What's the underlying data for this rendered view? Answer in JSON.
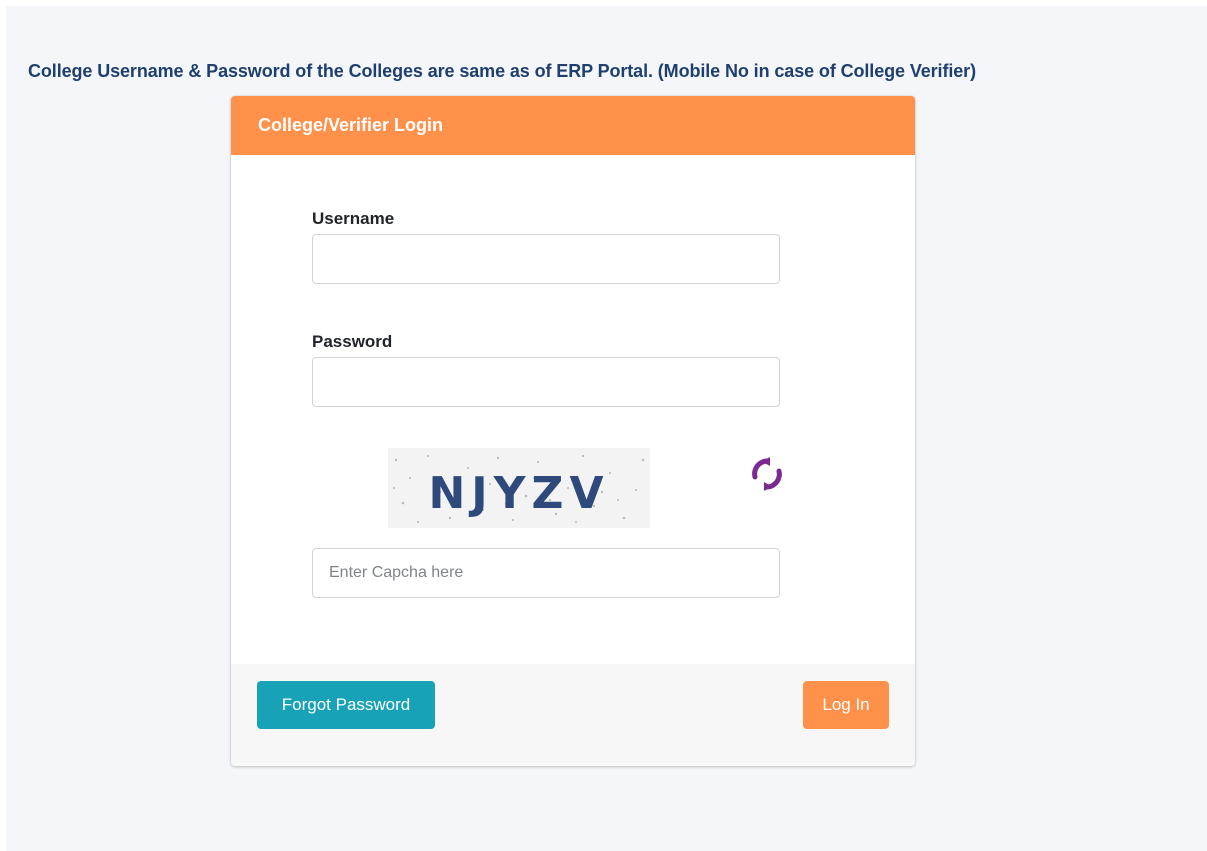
{
  "notice": "College Username & Password of the Colleges are same as of ERP Portal. (Mobile No in case of College Verifier)",
  "card": {
    "title": "College/Verifier Login"
  },
  "form": {
    "username_label": "Username",
    "username_value": "",
    "password_label": "Password",
    "password_value": "",
    "captcha_text": "NJYZV",
    "captcha_placeholder": "Enter Capcha here",
    "captcha_value": "",
    "refresh_icon": "refresh-icon"
  },
  "footer": {
    "forgot_label": "Forgot Password",
    "login_label": "Log In"
  },
  "colors": {
    "header": "#ff914a",
    "notice_text": "#1f3f6e",
    "forgot_button": "#17a2b8",
    "login_button": "#ff914a",
    "refresh_icon": "#7b2a8f",
    "captcha_text": "#2e4a7d"
  }
}
